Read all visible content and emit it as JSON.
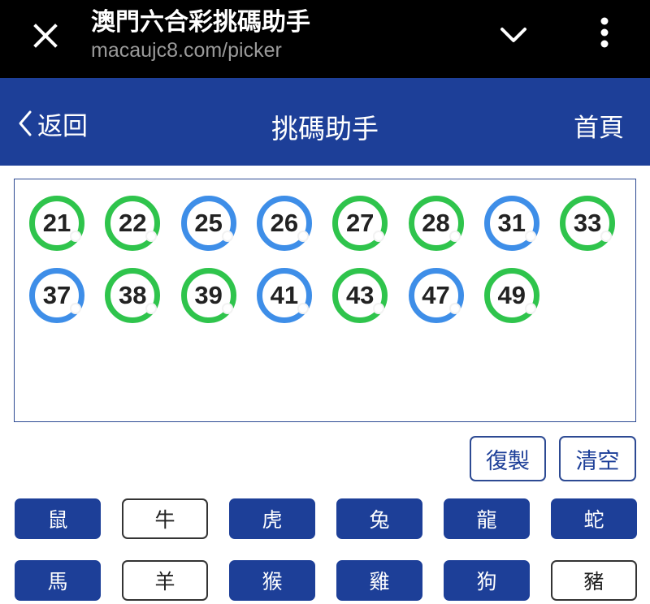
{
  "browser": {
    "page_title": "澳門六合彩挑碼助手",
    "url": "macaujc8.com/picker",
    "close_icon": "close-icon",
    "chevron_icon": "chevron-down-icon",
    "menu_icon": "more-vertical-icon"
  },
  "header": {
    "back_label": "返回",
    "title": "挑碼助手",
    "home_label": "首頁",
    "background": "#1d3f98"
  },
  "selected_numbers": [
    {
      "number": "21",
      "color": "green"
    },
    {
      "number": "22",
      "color": "green"
    },
    {
      "number": "25",
      "color": "blue"
    },
    {
      "number": "26",
      "color": "blue"
    },
    {
      "number": "27",
      "color": "green"
    },
    {
      "number": "28",
      "color": "green"
    },
    {
      "number": "31",
      "color": "blue"
    },
    {
      "number": "33",
      "color": "green"
    },
    {
      "number": "37",
      "color": "blue"
    },
    {
      "number": "38",
      "color": "green"
    },
    {
      "number": "39",
      "color": "green"
    },
    {
      "number": "41",
      "color": "blue"
    },
    {
      "number": "43",
      "color": "green"
    },
    {
      "number": "47",
      "color": "blue"
    },
    {
      "number": "49",
      "color": "green"
    }
  ],
  "ball_colors": {
    "green": "#2fc44c",
    "blue": "#3e8ee8"
  },
  "actions": {
    "copy_label": "復製",
    "clear_label": "清空"
  },
  "zodiacs": [
    {
      "label": "鼠",
      "active": true
    },
    {
      "label": "牛",
      "active": false
    },
    {
      "label": "虎",
      "active": true
    },
    {
      "label": "兔",
      "active": true
    },
    {
      "label": "龍",
      "active": true
    },
    {
      "label": "蛇",
      "active": true
    },
    {
      "label": "馬",
      "active": true
    },
    {
      "label": "羊",
      "active": false
    },
    {
      "label": "猴",
      "active": true
    },
    {
      "label": "雞",
      "active": true
    },
    {
      "label": "狗",
      "active": true
    },
    {
      "label": "豬",
      "active": false
    }
  ]
}
